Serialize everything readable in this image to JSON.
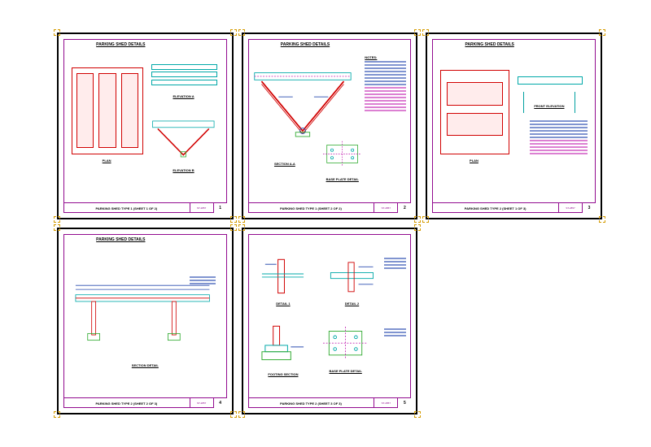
{
  "sheets": [
    {
      "header_title": "PARKING SHED DETAILS",
      "footer_title": "PARKING SHED TYPE 1 (SHEET 1 OF 2)",
      "sheet_no": "1",
      "title_block": "ST-2857",
      "views": [
        {
          "name": "PLAN",
          "pos": "bl"
        },
        {
          "name": "ELEVATION A",
          "pos": "tr"
        },
        {
          "name": "ELEVATION B",
          "pos": "br"
        }
      ]
    },
    {
      "header_title": "PARKING SHED DETAILS",
      "footer_title": "PARKING SHED TYPE 1 (SHEET 2 OF 2)",
      "sheet_no": "2",
      "title_block": "ST-2857",
      "views": [
        {
          "name": "SECTION A-A",
          "pos": "bl"
        },
        {
          "name": "BASE PLATE DETAIL",
          "pos": "br"
        }
      ],
      "notes_heading": "NOTES:"
    },
    {
      "header_title": "PARKING SHED DETAILS",
      "footer_title": "PARKING SHED TYPE 2 (SHEET 1 OF 3)",
      "sheet_no": "3",
      "title_block": "ST-2857",
      "views": [
        {
          "name": "PLAN",
          "pos": "bl"
        },
        {
          "name": "FRONT ELEVATION",
          "pos": "tr"
        }
      ]
    },
    {
      "header_title": "PARKING SHED DETAILS",
      "footer_title": "PARKING SHED TYPE 2 (SHEET 2 OF 3)",
      "sheet_no": "4",
      "title_block": "ST-2857",
      "views": [
        {
          "name": "SECTION DETAIL",
          "pos": "bc"
        }
      ]
    },
    {
      "header_title": "",
      "footer_title": "PARKING SHED TYPE 2 (SHEET 3 OF 3)",
      "sheet_no": "5",
      "title_block": "ST-2857",
      "views": [
        {
          "name": "DETAIL 1",
          "pos": "tl"
        },
        {
          "name": "DETAIL 2",
          "pos": "tr"
        },
        {
          "name": "FOOTING SECTION",
          "pos": "bl"
        },
        {
          "name": "BASE PLATE DETAIL",
          "pos": "br"
        }
      ]
    }
  ]
}
